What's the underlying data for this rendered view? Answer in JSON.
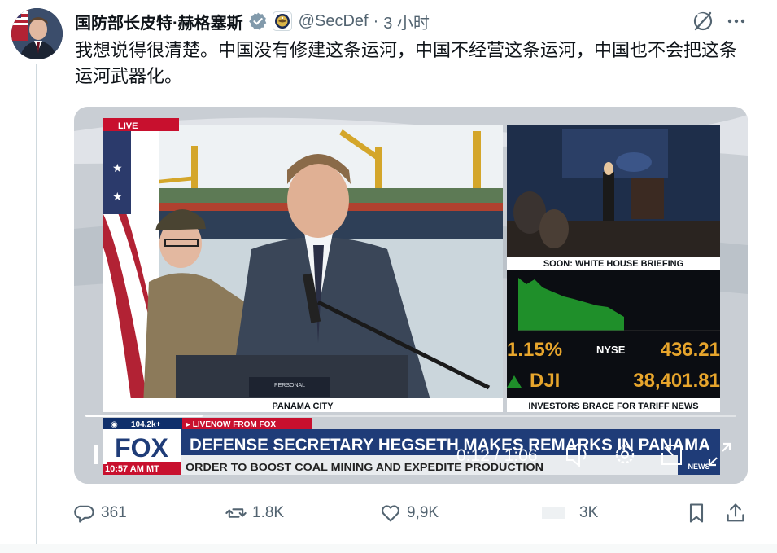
{
  "post": {
    "author_name": "国防部长皮特·赫格塞斯",
    "handle": "@SecDef",
    "separator": "·",
    "time": "3 小时",
    "text": "我想说得很清楚。中国没有修建这条运河，中国不经营这条运河，中国也不会把这条运河武器化。"
  },
  "video": {
    "live_tag": "LIVE",
    "location_caption": "PANAMA CITY",
    "side_top_caption": "SOON: WHITE HOUSE BRIEFING",
    "side_bottom_caption": "INVESTORS BRACE FOR TARIFF NEWS",
    "ticker_pct": "1.15%",
    "ticker_exchange": "NYSE",
    "ticker_value_1": "436.21",
    "ticker_index": "DJI",
    "ticker_value_2": "38,401.81",
    "views": "104.2k+",
    "livenow": "▸ LIVENOW FROM FOX",
    "network": "FOX",
    "time_stamp": "10:57 AM MT",
    "headline": "DEFENSE SECRETARY HEGSETH MAKES REMARKS IN PANAMA",
    "crawl": "ORDER TO BOOST COAL MINING AND EXPEDITE PRODUCTION",
    "network_small": "NEWS",
    "elapsed": "0:12",
    "duration": "1:06",
    "time_sep": "/",
    "progress": 0.18,
    "podium_label": "PERSONAL"
  },
  "actions": {
    "replies": "361",
    "reposts": "1.8K",
    "likes": "9,9K",
    "views": "3K"
  },
  "colors": {
    "verified": "#829aab",
    "text": "#0f1419",
    "secondary": "#536471",
    "fox_red": "#c8102e",
    "fox_blue": "#1f3c78",
    "market_green": "#1f8f2a"
  },
  "icons": {
    "verified": "verified-badge-icon",
    "affiliate": "dod-seal-icon",
    "grok": "grok-icon",
    "more": "more-icon",
    "play_pause": "pause-icon",
    "volume": "volume-icon",
    "settings": "settings-gear-icon",
    "pip": "picture-in-picture-icon",
    "fullscreen": "fullscreen-icon",
    "reply": "reply-icon",
    "repost": "repost-icon",
    "like": "heart-icon",
    "bookmark": "bookmark-icon",
    "share": "share-icon"
  }
}
